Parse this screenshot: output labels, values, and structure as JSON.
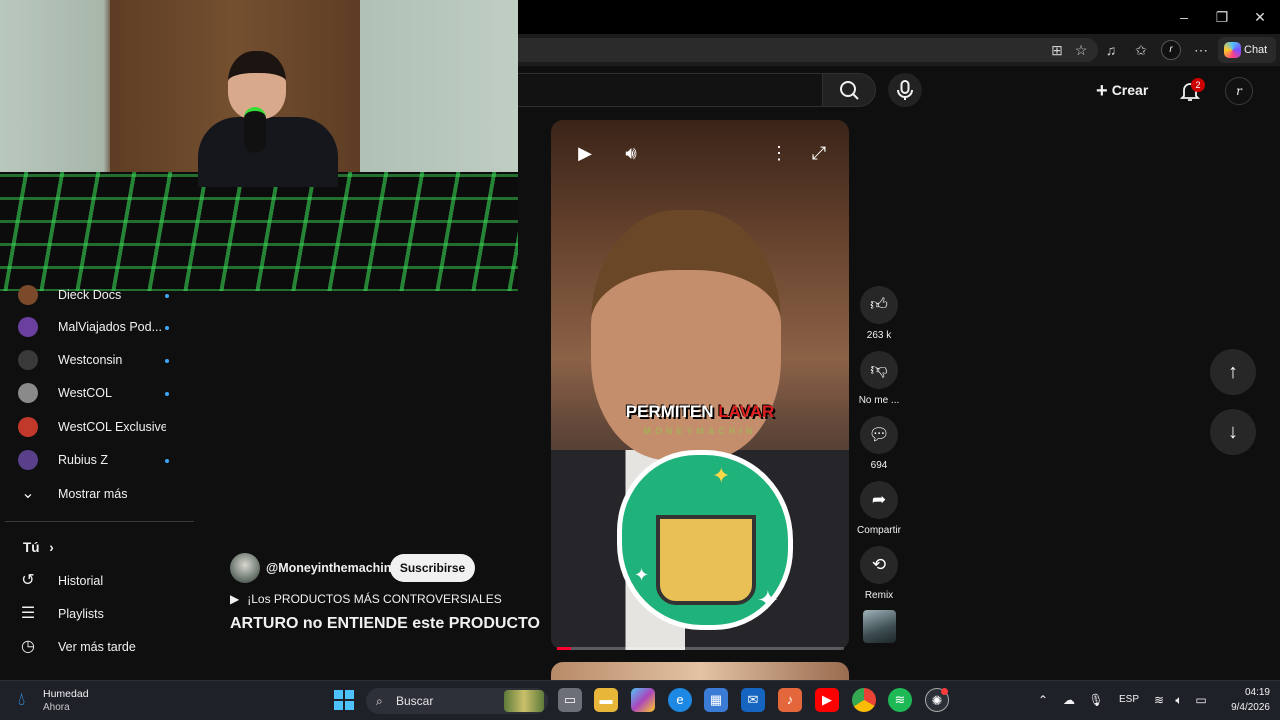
{
  "window": {
    "minimize": "–",
    "restore": "❐",
    "close": "✕",
    "chat_label": "Chat",
    "profile_initial": "r"
  },
  "yt_header": {
    "create_label": "Crear",
    "notification_count": "2",
    "account_initial": "r"
  },
  "sidebar": {
    "subscriptions": [
      {
        "name": "Dieck Docs",
        "avatar_color": "#7a4a2a"
      },
      {
        "name": "MalViajados Pod...",
        "avatar_color": "#6b3fa0"
      },
      {
        "name": "Westconsin",
        "avatar_color": "#3a3a3a"
      },
      {
        "name": "WestCOL",
        "avatar_color": "#8a8a8a"
      },
      {
        "name": "WestCOL Exclusive",
        "avatar_color": "#c0392b"
      },
      {
        "name": "Rubius Z",
        "avatar_color": "#5a3f8a"
      }
    ],
    "show_more": "Mostrar más",
    "you_heading": "Tú",
    "you_items": [
      {
        "label": "Historial",
        "icon": "history-icon"
      },
      {
        "label": "Playlists",
        "icon": "playlists-icon"
      },
      {
        "label": "Ver más tarde",
        "icon": "watch-later-icon"
      }
    ]
  },
  "short": {
    "overlay_word1": "PERMITEN",
    "overlay_word2": "LAVAR",
    "overlay_sub": "MONEYMACHIN",
    "progress": 0.05,
    "channel": "@Moneyinthemachine",
    "subscribe_label": "Suscribirse",
    "playlist": "¡Los PRODUCTOS MÁS CONTROVERSIALES",
    "title": "ARTURO no ENTIENDE este PRODUCTO"
  },
  "actions": {
    "likes": "263 k",
    "dislike_label": "No me ...",
    "comments": "694",
    "share_label": "Compartir",
    "remix_label": "Remix"
  },
  "taskbar": {
    "weather_title": "Humedad",
    "weather_sub": "Ahora",
    "search_label": "Buscar",
    "language": "ESP",
    "time": "04:19",
    "date": "9/4/2026"
  }
}
